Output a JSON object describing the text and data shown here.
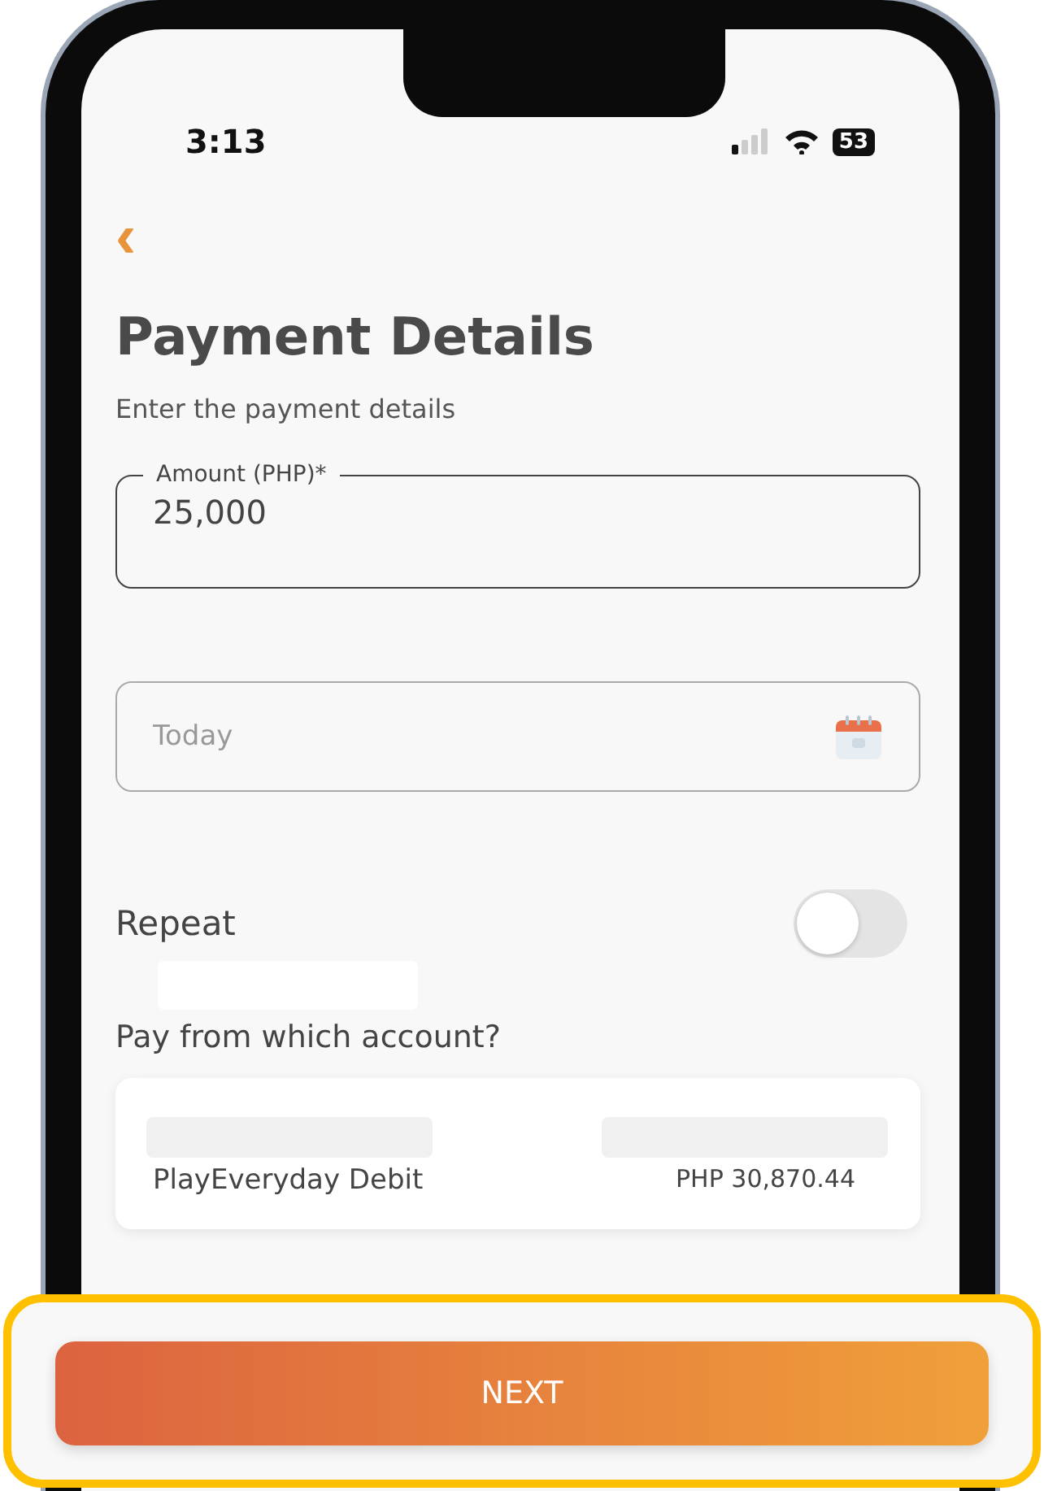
{
  "status_bar": {
    "time": "3:13",
    "battery": "53"
  },
  "header": {
    "back": "‹",
    "title": "Payment Details",
    "subtitle": "Enter the payment details"
  },
  "amount_field": {
    "label": "Amount (PHP)*",
    "value": "25,000"
  },
  "date_field": {
    "placeholder": "Today"
  },
  "repeat": {
    "label": "Repeat",
    "on": false
  },
  "account_section": {
    "heading": "Pay from which account?"
  },
  "account_card": {
    "name": "PlayEveryday Debit",
    "balance": "PHP 30,870.44"
  },
  "next_button": {
    "label": "NEXT"
  }
}
